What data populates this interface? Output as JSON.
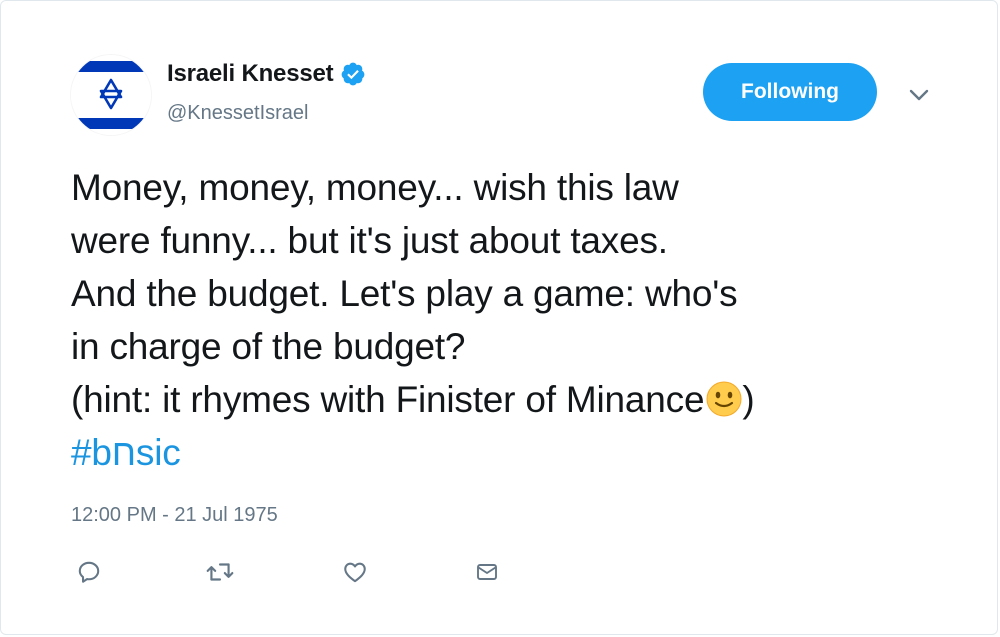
{
  "tweet": {
    "author": {
      "display_name": "Israeli Knesset",
      "handle": "@KnessetIsrael",
      "verified": true,
      "avatar_icon": "israel-flag-icon"
    },
    "follow_button_label": "Following",
    "menu_icon": "chevron-down-icon",
    "text_lines": [
      "Money, money, money... wish this law",
      "were funny... but it's just about taxes.",
      "And the budget. Let's play a game: who's",
      "in charge of the budget?",
      "(hint: it rhymes with Finister of Minance",
      ")"
    ],
    "hashtag": "#bחsic",
    "emoji": "slightly-smiling-face-icon",
    "timestamp": "12:00 PM - 21 Jul 1975",
    "actions": [
      "reply-icon",
      "retweet-icon",
      "like-icon",
      "message-icon"
    ]
  },
  "colors": {
    "brand_blue": "#1da1f2",
    "hashtag_blue": "#1b95e0",
    "text_primary": "#14171a",
    "text_secondary": "#657786",
    "flag_blue": "#0038b8"
  }
}
